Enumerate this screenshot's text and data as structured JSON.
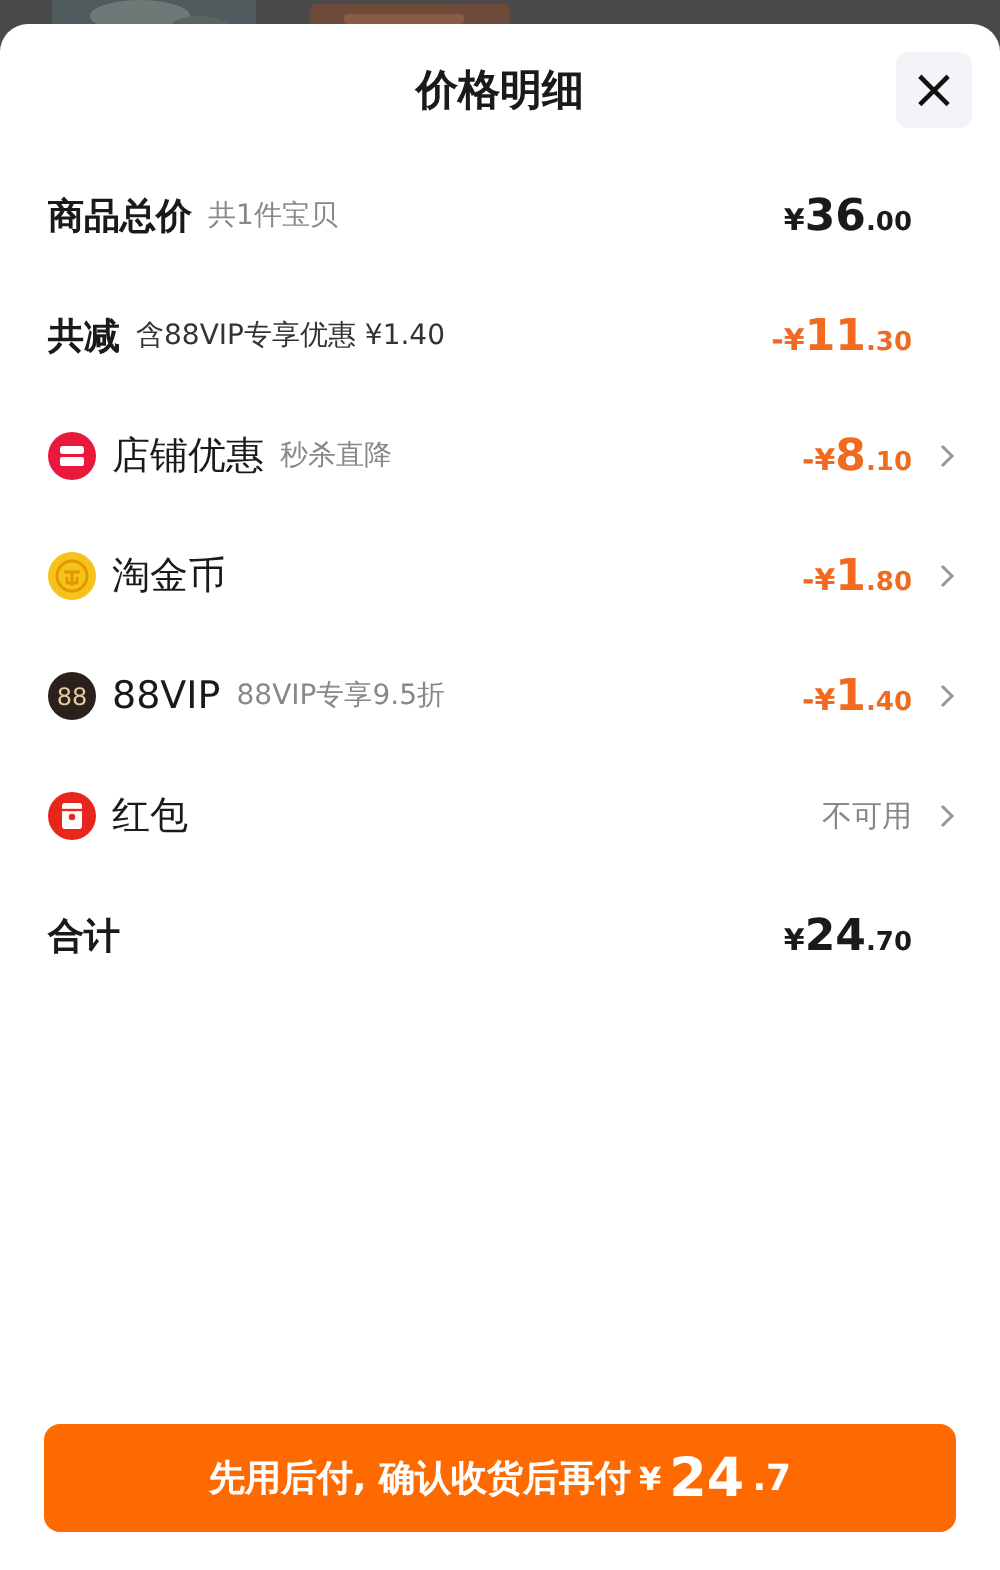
{
  "sheet": {
    "title": "价格明细",
    "close_label": "×"
  },
  "rows": [
    {
      "kind": "summary",
      "label": "商品总价",
      "note": "共1件宝贝",
      "amount": {
        "color": "#1a1a1a",
        "prefix": "¥",
        "main": "36",
        "cents": ".00"
      },
      "chevron": false
    },
    {
      "kind": "summary",
      "label": "共减",
      "note": "含88VIP专享优惠 ¥1.40",
      "amount": {
        "color": "#f06a1f",
        "prefix": "-¥",
        "main": "11",
        "cents": ".30"
      },
      "chevron": false
    },
    {
      "kind": "store",
      "label": "店铺优惠",
      "note": "秒杀直降",
      "amount": {
        "color": "#f06a1f",
        "prefix": "-¥",
        "main": "8",
        "cents": ".10"
      },
      "chevron": true
    },
    {
      "kind": "coins",
      "label": "淘金币",
      "amount": {
        "color": "#f06a1f",
        "prefix": "-¥",
        "main": "1",
        "cents": ".80"
      },
      "chevron": true
    },
    {
      "kind": "vip",
      "icon_text": "88",
      "label": "88VIP",
      "note": "88VIP专享9.5折",
      "amount": {
        "color": "#f06a1f",
        "prefix": "-¥",
        "main": "1",
        "cents": ".40"
      },
      "chevron": true
    },
    {
      "kind": "packet",
      "label": "红包",
      "status": "不可用",
      "chevron": true
    },
    {
      "kind": "total",
      "label": "合计",
      "amount": {
        "color": "#1a1a1a",
        "prefix": "¥",
        "main": "24",
        "cents": ".70"
      },
      "chevron": false
    }
  ],
  "pay_button": {
    "label": "先用后付, 确认收货后再付",
    "prefix": "¥",
    "main": "24",
    "cents": ".7"
  }
}
